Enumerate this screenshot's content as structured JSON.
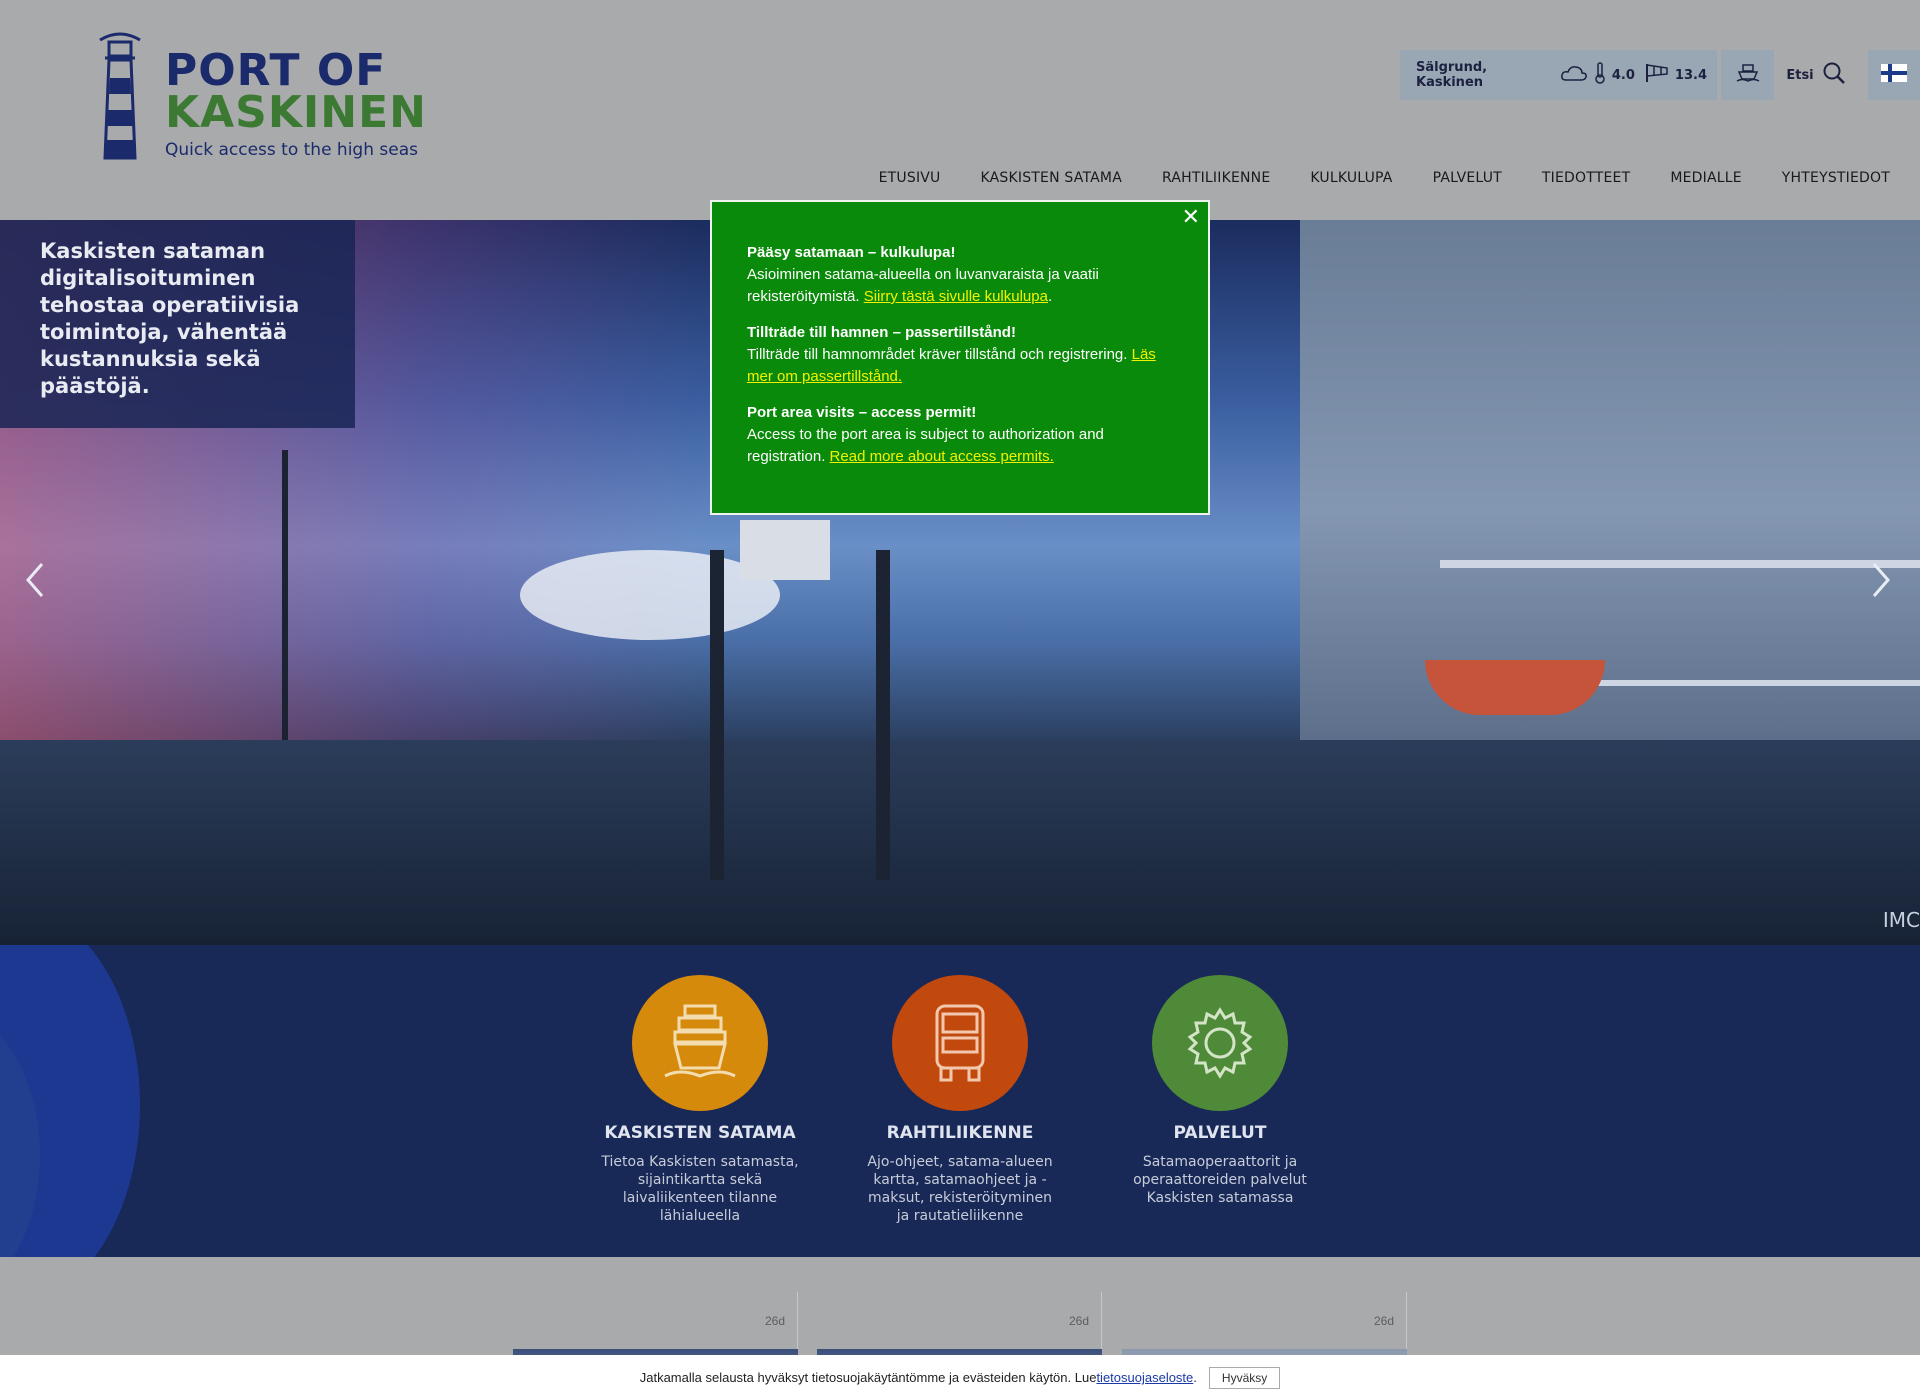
{
  "logo": {
    "line1": "PORT OF",
    "line2": "KASKINEN",
    "tagline": "Quick access to the high seas"
  },
  "weather": {
    "location": "Sälgrund, Kaskinen",
    "weather_icon": "cloud-icon",
    "temperature": "4.0",
    "wind": "13.4"
  },
  "search": {
    "label": "Etsi"
  },
  "nav": {
    "items": [
      "ETUSIVU",
      "KASKISTEN SATAMA",
      "RAHTILIIKENNE",
      "KULKULUPA",
      "PALVELUT",
      "TIEDOTTEET",
      "MEDIALLE",
      "YHTEYSTIEDOT"
    ]
  },
  "hero": {
    "caption": "Kaskisten sataman digitalisoituminen tehostaa operatiivisia toimintoja, vähentää kustannuksia sekä päästöjä."
  },
  "popup": {
    "close": "✕",
    "fi_title": "Pääsy satamaan – kulkulupa!",
    "fi_text": "Asioiminen satama-alueella on luvanvaraista ja vaatii rekisteröitymistä. ",
    "fi_link": "Siirry tästä sivulle kulkulupa",
    "sv_title": "Tillträde till hamnen – passertillstånd!",
    "sv_text": "Tillträde till hamnområdet kräver tillstånd och registrering. ",
    "sv_link": "Läs mer om passertillstånd.",
    "en_title": "Port area visits – access permit!",
    "en_text": "Access to the port area is subject to authorization and registration. ",
    "en_link": "Read more about access permits."
  },
  "services": [
    {
      "title": "KASKISTEN SATAMA",
      "desc": "Tietoa Kaskisten satamasta, sijaintikartta sekä laivaliikenteen tilanne lähialueella",
      "color": "#d68a0c",
      "icon": "ship-icon"
    },
    {
      "title": "RAHTILIIKENNE",
      "desc": "Ajo-ohjeet, satama-alueen kartta, satamaohjeet ja -maksut, rekisteröityminen ja rautatieliikenne",
      "color": "#c2490e",
      "icon": "truck-icon"
    },
    {
      "title": "PALVELUT",
      "desc": "Satamaoperaattorit ja operaattoreiden palvelut Kaskisten satamassa",
      "color": "#4f8a38",
      "icon": "gear-icon"
    }
  ],
  "news": [
    {
      "age": "26d"
    },
    {
      "age": "26d"
    },
    {
      "age": "26d"
    }
  ],
  "cookie": {
    "text": "Jatkamalla selausta hyväksyt tietosuojakäytäntömme ja evästeiden käytön. Lue ",
    "link": "tietosuojaseloste",
    "after": ".",
    "accept": "Hyväksy"
  },
  "hero_watermark": "IMC"
}
